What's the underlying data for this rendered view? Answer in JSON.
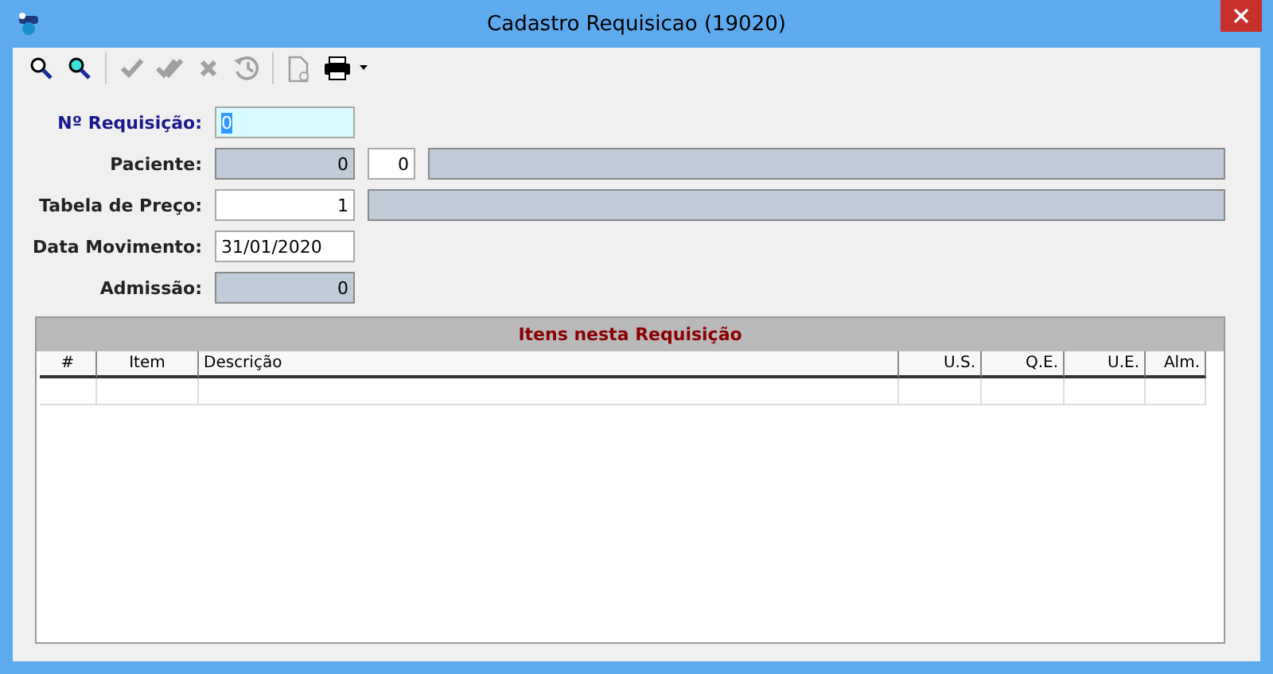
{
  "window": {
    "title": "Cadastro Requisicao (19020)"
  },
  "toolbar": [
    {
      "kind": "search",
      "disabled": false
    },
    {
      "kind": "search-alt",
      "disabled": false
    },
    {
      "kind": "separator"
    },
    {
      "kind": "check",
      "disabled": true
    },
    {
      "kind": "double-check",
      "disabled": true
    },
    {
      "kind": "cancel",
      "disabled": true
    },
    {
      "kind": "history",
      "disabled": true
    },
    {
      "kind": "separator"
    },
    {
      "kind": "document",
      "disabled": true
    },
    {
      "kind": "print",
      "disabled": false
    }
  ],
  "fields": [
    {
      "label": "Nº Requisição:",
      "focused": true,
      "inputs": [
        {
          "kind": "short",
          "value": "0",
          "readonly": false
        }
      ]
    },
    {
      "label": "Paciente:",
      "focused": false,
      "inputs": [
        {
          "kind": "short",
          "value": "0",
          "readonly": true
        },
        {
          "kind": "code",
          "value": "0",
          "readonly": false
        },
        {
          "kind": "long",
          "readonly": true
        }
      ]
    },
    {
      "label": "Tabela de Preço:",
      "focused": false,
      "inputs": [
        {
          "kind": "short",
          "value": "1",
          "readonly": false
        },
        {
          "kind": "long",
          "readonly": true
        }
      ]
    },
    {
      "label": "Data Movimento:",
      "focused": false,
      "inputs": [
        {
          "kind": "date",
          "value": "31/01/2020",
          "readonly": false
        }
      ]
    },
    {
      "label": "Admissão:",
      "focused": false,
      "inputs": [
        {
          "kind": "short",
          "value": "0",
          "readonly": true
        }
      ]
    }
  ],
  "grid": {
    "title": "Itens nesta Requisição",
    "columns": [
      "#",
      "Item",
      "Descrição",
      "U.S.",
      "Q.E.",
      "U.E.",
      "Alm."
    ]
  }
}
